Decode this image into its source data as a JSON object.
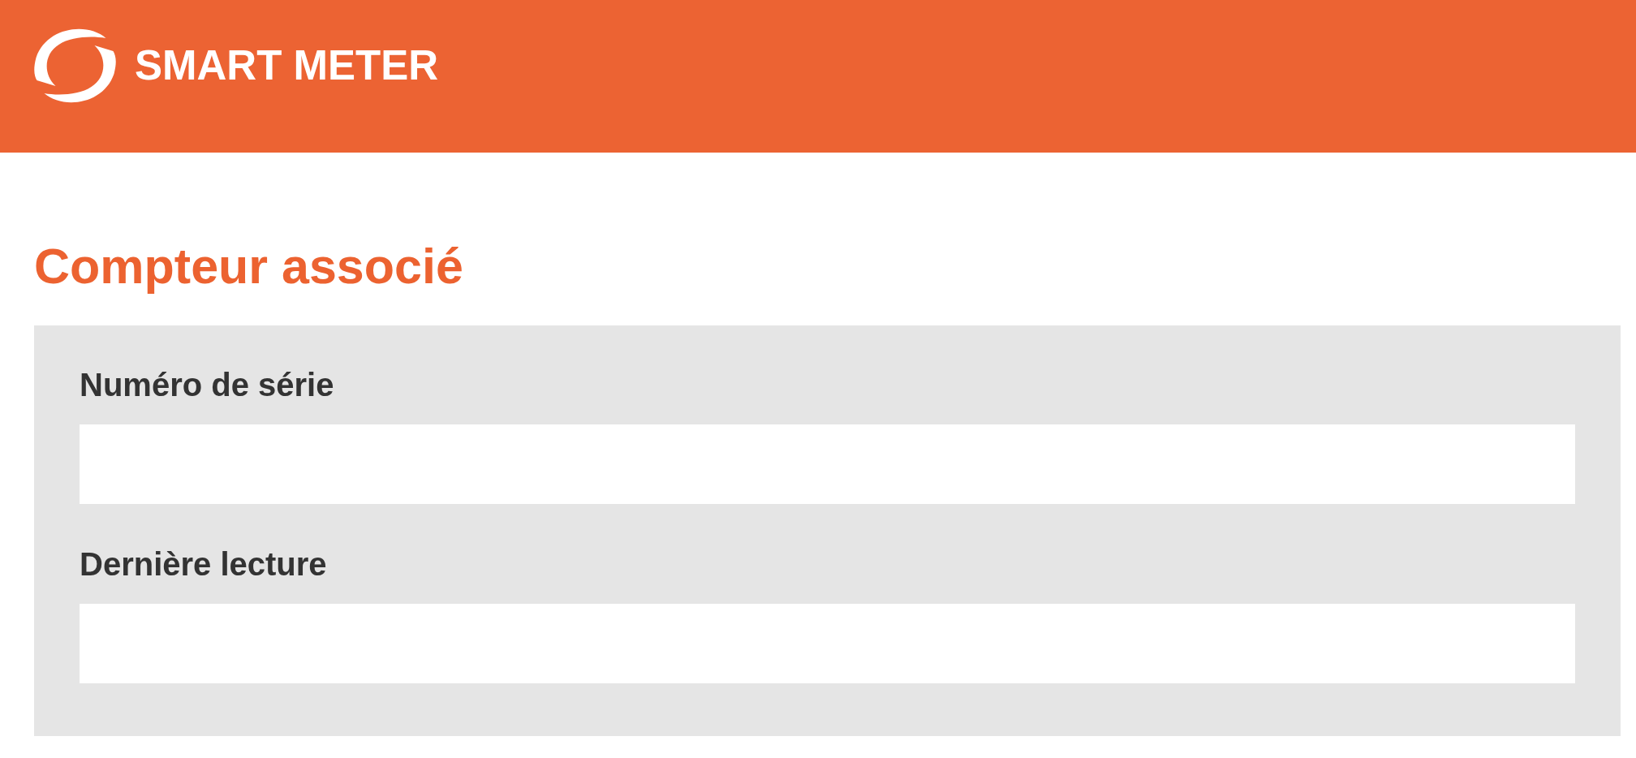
{
  "header": {
    "title": "SMART METER"
  },
  "section": {
    "heading": "Compteur associé"
  },
  "form": {
    "fields": [
      {
        "label": "Numéro de série"
      },
      {
        "label": "Dernière lecture"
      }
    ]
  }
}
